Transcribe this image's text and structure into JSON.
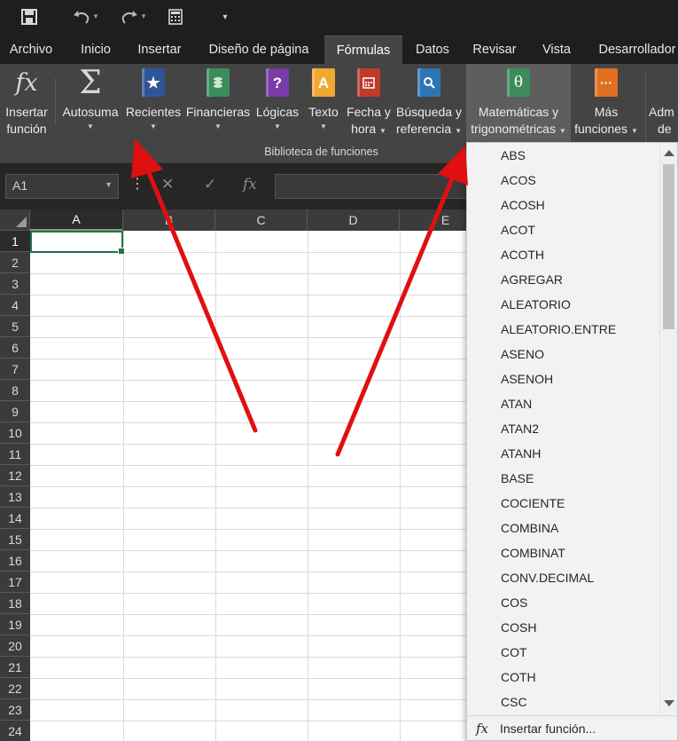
{
  "qat": {
    "save_icon": "save-icon",
    "undo_icon": "undo-icon",
    "redo_icon": "redo-icon",
    "calc_icon": "calculator-icon",
    "customize_icon": "customize-icon"
  },
  "tabs": [
    {
      "label": "Archivo"
    },
    {
      "label": "Inicio"
    },
    {
      "label": "Insertar"
    },
    {
      "label": "Diseño de página"
    },
    {
      "label": "Fórmulas"
    },
    {
      "label": "Datos"
    },
    {
      "label": "Revisar"
    },
    {
      "label": "Vista"
    },
    {
      "label": "Desarrollador"
    }
  ],
  "ribbon": {
    "insert_function": {
      "line1": "Insertar",
      "line2": "función",
      "icon": "fx-icon"
    },
    "autosum": {
      "label": "Autosuma",
      "icon": "sigma-icon"
    },
    "recent": {
      "label": "Recientes",
      "icon": "star-book-icon",
      "color": "#2f5597"
    },
    "financial": {
      "label": "Financieras",
      "icon": "coins-book-icon",
      "color": "#3b8c5a"
    },
    "logical": {
      "label": "Lógicas",
      "icon": "question-book-icon",
      "color": "#7a3aa8"
    },
    "text": {
      "label": "Texto",
      "icon": "letter-a-book-icon",
      "color": "#f0a830"
    },
    "datetime": {
      "line1": "Fecha y",
      "line2": "hora",
      "icon": "calendar-book-icon",
      "color": "#c0392b"
    },
    "lookup": {
      "line1": "Búsqueda y",
      "line2": "referencia",
      "icon": "magnifier-book-icon",
      "color": "#2e75b6"
    },
    "math": {
      "line1": "Matemáticas y",
      "line2": "trigonométricas",
      "icon": "theta-book-icon",
      "color": "#3b8c5a"
    },
    "more": {
      "line1": "Más",
      "line2": "funciones",
      "icon": "dots-book-icon",
      "color": "#e07020"
    },
    "admin": {
      "line1": "Adm",
      "line2": "de"
    },
    "group_label": "Biblioteca de funciones"
  },
  "formula_bar": {
    "name_box": "A1",
    "fx_label": "fx"
  },
  "sheet": {
    "columns": [
      "A",
      "B",
      "C",
      "D",
      "E"
    ],
    "rows": [
      "1",
      "2",
      "3",
      "4",
      "5",
      "6",
      "7",
      "8",
      "9",
      "10",
      "11",
      "12",
      "13",
      "14",
      "15",
      "16",
      "17",
      "18",
      "19",
      "20",
      "21",
      "22",
      "23",
      "24"
    ]
  },
  "dropdown": {
    "items": [
      "ABS",
      "ACOS",
      "ACOSH",
      "ACOT",
      "ACOTH",
      "AGREGAR",
      "ALEATORIO",
      "ALEATORIO.ENTRE",
      "ASENO",
      "ASENOH",
      "ATAN",
      "ATAN2",
      "ATANH",
      "BASE",
      "COCIENTE",
      "COMBINA",
      "COMBINAT",
      "CONV.DECIMAL",
      "COS",
      "COSH",
      "COT",
      "COTH",
      "CSC"
    ],
    "footer_label": "Insertar función...",
    "footer_icon": "fx"
  },
  "annotations": {
    "arrow_color": "#e01010"
  }
}
